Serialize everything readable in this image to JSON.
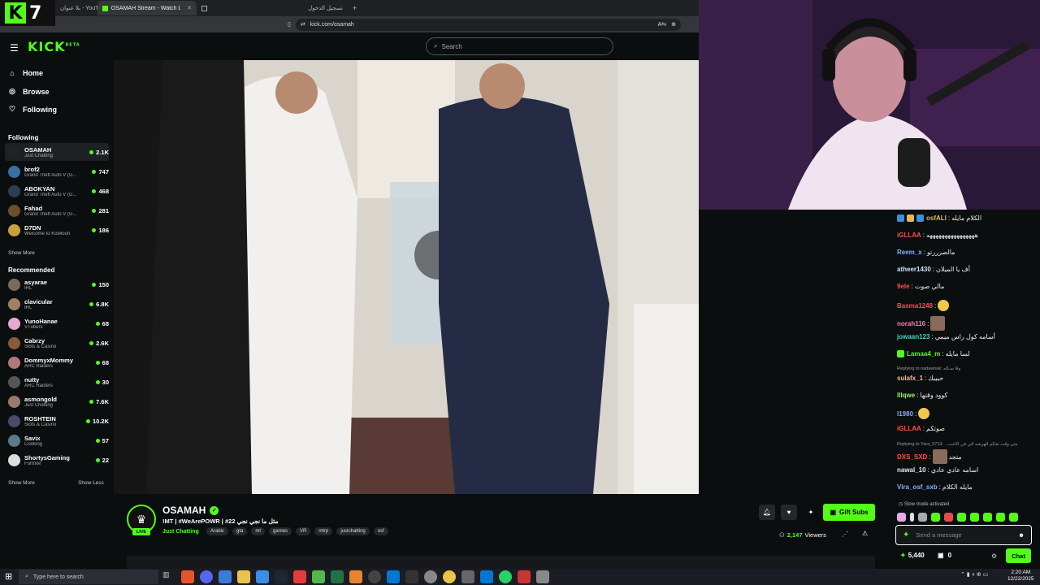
{
  "browser": {
    "overlay_number": "7",
    "tabs": [
      {
        "label": "بلا عنوان - YouTube"
      },
      {
        "label": "OSAMAH Stream - Watch Live o",
        "close": "✕"
      },
      {
        "label": ""
      },
      {
        "label": "تسجيل الدخول"
      }
    ],
    "new_tab": "+",
    "url": "kick.com/osamah"
  },
  "header": {
    "logo": "KICK",
    "logo_sup": "BETA",
    "search_placeholder": "Search"
  },
  "sidebar": {
    "nav": [
      {
        "label": "Home",
        "icon": "home-icon"
      },
      {
        "label": "Browse",
        "icon": "compass-icon"
      },
      {
        "label": "Following",
        "icon": "heart-icon"
      }
    ],
    "following_title": "Following",
    "following": [
      {
        "name": "OSAMAH",
        "category": "Just Chatting",
        "viewers": "2.1K",
        "color": "#222222"
      },
      {
        "name": "brof2",
        "category": "Grand Theft Auto V (G...",
        "viewers": "747",
        "color": "#3a6ea5"
      },
      {
        "name": "ABOKYAN",
        "category": "Grand Theft Auto V (G...",
        "viewers": "468",
        "color": "#2c3e50"
      },
      {
        "name": "Fahad",
        "category": "Grand Theft Auto V (G...",
        "viewers": "281",
        "color": "#6b4f2a"
      },
      {
        "name": "D7DN",
        "category": "Welcome to Kowloon",
        "viewers": "186",
        "color": "#c9a13b"
      }
    ],
    "show_more_1": "Show More",
    "recommended_title": "Recommended",
    "recommended": [
      {
        "name": "asyarae",
        "category": "IRL",
        "viewers": "150",
        "color": "#7a6a5a"
      },
      {
        "name": "clavicular",
        "category": "IRL",
        "viewers": "6.8K",
        "color": "#a08060"
      },
      {
        "name": "YunoHanae",
        "category": "VTubers",
        "viewers": "68",
        "color": "#e8a8d0"
      },
      {
        "name": "Cabrzy",
        "category": "Slots & Casino",
        "viewers": "2.6K",
        "color": "#8a5a3a"
      },
      {
        "name": "DommyxMommy",
        "category": "ARC Raiders",
        "viewers": "68",
        "color": "#b07a7a"
      },
      {
        "name": "nutty",
        "category": "ARC Raiders",
        "viewers": "30",
        "color": "#555555"
      },
      {
        "name": "asmongold",
        "category": "Just Chatting",
        "viewers": "7.6K",
        "color": "#9a7a6a"
      },
      {
        "name": "ROSHTEIN",
        "category": "Slots & Casino",
        "viewers": "10.2K",
        "color": "#4a4a6a"
      },
      {
        "name": "Savix",
        "category": "Cooking",
        "viewers": "57",
        "color": "#5a7a8a"
      },
      {
        "name": "ShortysGaming",
        "category": "Fortnite",
        "viewers": "22",
        "color": "#dddddd"
      }
    ],
    "show_more_2": "Show More",
    "show_less": "Show Less"
  },
  "stream": {
    "live_badge": "LIVE",
    "name": "OSAMAH",
    "title": "!MT | #WeArePOWR | #22 مثل ما نجي نجي",
    "category": "Just Chatting",
    "tags": [
      "Arabic",
      "gta",
      "mt",
      "games",
      "VR",
      "mtrp",
      "justchatting",
      "osf"
    ],
    "gift_label": "Gift Subs",
    "viewers_count": "2,147",
    "viewers_label": "Viewers"
  },
  "chat": {
    "messages": [
      {
        "user": "osfALI",
        "text": "الكلام مايله",
        "color": "#e8b84a",
        "badges": [
          "#3a8ee8",
          "#e8b84a",
          "#3a8ee8"
        ]
      },
      {
        "user": "iGLLAA",
        "text": "ههههههههههههههههه",
        "color": "#ff4d4d"
      },
      {
        "user": "Reem_x",
        "text": "مالصرررتو",
        "color": "#7fb2ff"
      },
      {
        "user": "atheer1430",
        "text": "أف يا الميلان",
        "color": "#c9e2ff"
      },
      {
        "user": "9ele",
        "text": "مالي صوت",
        "color": "#ff4d4d"
      },
      {
        "user": "Basma1248",
        "text": "",
        "color": "#ff4d4d",
        "emote": "round"
      },
      {
        "user": "norah116",
        "text": "",
        "color": "#ff7aa8",
        "emote": "square"
      },
      {
        "user": "jowaan123",
        "text": "أسامه كول راس ميمي",
        "color": "#4dd0c4"
      },
      {
        "user": "Lamaa4_m",
        "text": "لسا مايله",
        "color": "#53fc18",
        "badges": [
          "#53fc18"
        ]
      },
      {
        "user": "sulafx_1",
        "text": "حبيبك",
        "color": "#ffb3a0"
      },
      {
        "user": "lllqwe",
        "text": "كوود وقتها",
        "color": "#9cf06a"
      },
      {
        "user": "l1980",
        "text": "",
        "color": "#7fb2ff",
        "emote": "round"
      },
      {
        "user": "iGLLAA",
        "text": "صوتكم",
        "color": "#ff4d4d"
      },
      {
        "user": "DXS_SXD",
        "text": "متجد",
        "color": "#ff4d4d",
        "emote": "square"
      },
      {
        "user": "nawal_10",
        "text": "اسامه عادي عادي",
        "color": "#e8e8e8"
      },
      {
        "user": "Vira_osf_sxb",
        "text": "مايله الكلام",
        "color": "#7fb2ff"
      }
    ],
    "reply_1": "Replying to nadawirak: وقا سـاله",
    "reply_2": "Replying to Yara_5713: ...متى وقت تحكم الهرشه الي في الاعب",
    "slow_mode": "Slow mode activated",
    "input_placeholder": "Send a message",
    "points": "5,440",
    "subs_count": "0",
    "chat_button": "Chat"
  },
  "taskbar": {
    "search_placeholder": "Type here to search",
    "time": "2:20 AM",
    "date": "12/22/2025"
  }
}
